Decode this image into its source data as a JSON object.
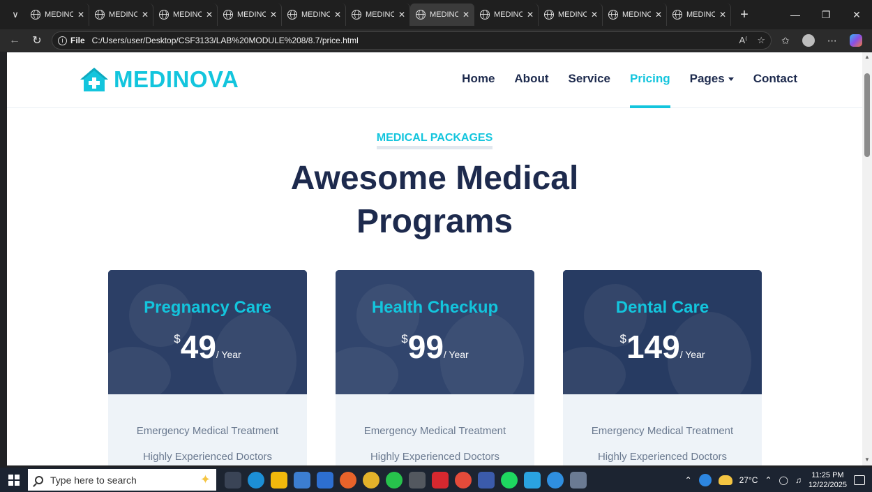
{
  "browser": {
    "tabs": [
      {
        "title": "MEDINOVA",
        "active": false
      },
      {
        "title": "MEDINOVA",
        "active": false
      },
      {
        "title": "MEDINOVA",
        "active": false
      },
      {
        "title": "MEDINOVA",
        "active": false
      },
      {
        "title": "MEDINOVA",
        "active": false
      },
      {
        "title": "MEDINOVA",
        "active": false
      },
      {
        "title": "MEDINOVA",
        "active": true
      },
      {
        "title": "MEDINOVA",
        "active": false
      },
      {
        "title": "MEDINOVA",
        "active": false
      },
      {
        "title": "MEDINOVA",
        "active": false
      },
      {
        "title": "MEDINOVA",
        "active": false
      }
    ],
    "address": {
      "scheme_label": "File",
      "url": "C:/Users/user/Desktop/CSF3133/LAB%20MODULE%208/8.7/price.html"
    }
  },
  "site": {
    "brand": "MEDINOVA",
    "brand_color": "#13c5dd",
    "nav": [
      {
        "label": "Home",
        "active": false
      },
      {
        "label": "About",
        "active": false
      },
      {
        "label": "Service",
        "active": false
      },
      {
        "label": "Pricing",
        "active": true
      },
      {
        "label": "Pages",
        "active": false,
        "dropdown": true
      },
      {
        "label": "Contact",
        "active": false
      }
    ],
    "section": {
      "kicker": "Medical Packages",
      "title_line1": "Awesome Medical",
      "title_line2": "Programs"
    },
    "plans": [
      {
        "name": "Pregnancy Care",
        "currency": "$",
        "price": "49",
        "period": "/ Year",
        "features": [
          "Emergency Medical Treatment",
          "Highly Experienced Doctors"
        ]
      },
      {
        "name": "Health Checkup",
        "currency": "$",
        "price": "99",
        "period": "/ Year",
        "features": [
          "Emergency Medical Treatment",
          "Highly Experienced Doctors"
        ]
      },
      {
        "name": "Dental Care",
        "currency": "$",
        "price": "149",
        "period": "/ Year",
        "features": [
          "Emergency Medical Treatment",
          "Highly Experienced Doctors"
        ]
      }
    ]
  },
  "taskbar": {
    "search_placeholder": "Type here to search",
    "weather": "27°C",
    "time": "11:25 PM",
    "date": "12/22/2025"
  }
}
